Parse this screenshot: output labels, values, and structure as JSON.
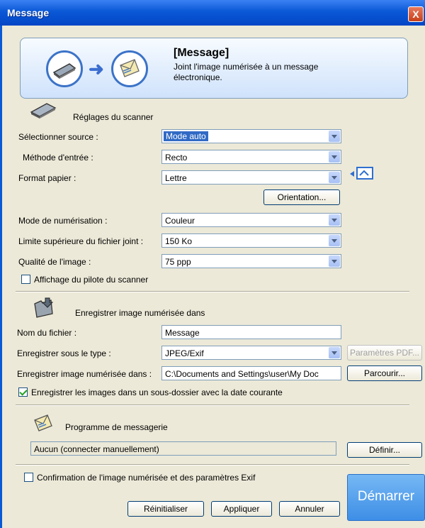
{
  "window": {
    "title": "Message",
    "close_label": "X"
  },
  "banner": {
    "title": "[Message]",
    "description": "Joint l'image numérisée à un message électronique."
  },
  "scanner_settings": {
    "title": "Réglages du scanner",
    "fields": [
      {
        "label": "Sélectionner source :",
        "value": "Mode auto"
      },
      {
        "label": "Méthode d'entrée :",
        "value": "Recto"
      },
      {
        "label": "Format papier :",
        "value": "Lettre"
      },
      {
        "label": "Mode de numérisation :",
        "value": "Couleur"
      },
      {
        "label": "Limite supérieure du fichier joint :",
        "value": "150 Ko"
      },
      {
        "label": "Qualité de l'image :",
        "value": "75 ppp"
      }
    ],
    "orientation_button": "Orientation...",
    "show_driver_label": "Affichage du pilote du scanner",
    "show_driver_checked": false
  },
  "save_settings": {
    "title": "Enregistrer image numérisée dans",
    "filename_label": "Nom du fichier :",
    "filename_value": "Message",
    "type_label": "Enregistrer sous le type :",
    "type_value": "JPEG/Exif",
    "pdf_button": "Paramètres PDF...",
    "path_label": "Enregistrer image numérisée dans :",
    "path_value": "C:\\Documents and Settings\\user\\My Doc",
    "browse_button": "Parcourir...",
    "subfolder_label": "Enregistrer les images dans un sous-dossier avec la date courante",
    "subfolder_checked": true
  },
  "mail_program": {
    "title": "Programme de messagerie",
    "value": "Aucun (connecter manuellement)",
    "define_button": "Définir..."
  },
  "footer": {
    "confirm_label": "Confirmation de l'image numérisée et des paramètres Exif",
    "confirm_checked": false,
    "reset_button": "Réinitialiser",
    "apply_button": "Appliquer",
    "cancel_button": "Annuler",
    "start_button": "Démarrer"
  },
  "colors": {
    "title_bar": "#0a58d6",
    "start_button": "#3d8ee6",
    "selection": "#316ac5"
  }
}
